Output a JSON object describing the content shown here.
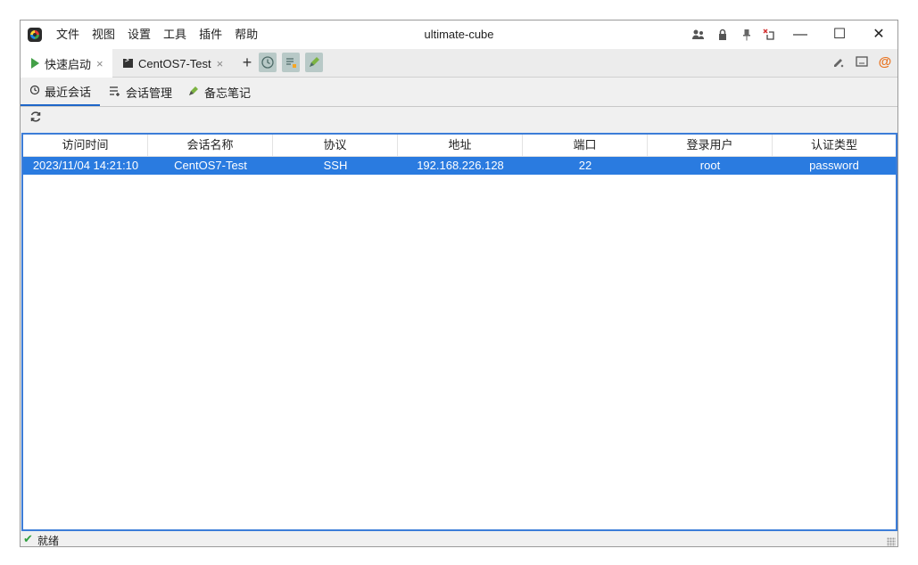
{
  "window": {
    "title": "ultimate-cube",
    "menu": [
      "文件",
      "视图",
      "设置",
      "工具",
      "插件",
      "帮助"
    ],
    "controls": {
      "minimize": "—",
      "maximize": "☐",
      "close": "✕"
    }
  },
  "titlebar_icons": [
    "users-icon",
    "lock-icon",
    "pin-icon",
    "restore-window-icon"
  ],
  "tabs": [
    {
      "label": "快速启动",
      "icon": "play-icon",
      "active": true
    },
    {
      "label": "CentOS7-Test",
      "icon": "terminal-icon",
      "active": false
    }
  ],
  "tab_close_glyph": "×",
  "toolbar_buttons": [
    "history-icon",
    "notes-list-icon",
    "edit-note-icon"
  ],
  "right_icons": [
    "pen-icon",
    "screenshot-icon",
    "at-icon"
  ],
  "subtabs": [
    {
      "label": "最近会话",
      "icon": "history-icon"
    },
    {
      "label": "会话管理",
      "icon": "session-manage-icon"
    },
    {
      "label": "备忘笔记",
      "icon": "note-icon"
    }
  ],
  "table": {
    "columns": [
      "访问时间",
      "会话名称",
      "协议",
      "地址",
      "端口",
      "登录用户",
      "认证类型"
    ],
    "rows": [
      [
        "2023/11/04 14:21:10",
        "CentOS7-Test",
        "SSH",
        "192.168.226.128",
        "22",
        "root",
        "password"
      ]
    ]
  },
  "status": {
    "text": "就绪"
  },
  "colors": {
    "accent": "#2a7be0",
    "border": "#3c7dd8",
    "play": "#43a047",
    "status_ok": "#2e9e3e"
  }
}
